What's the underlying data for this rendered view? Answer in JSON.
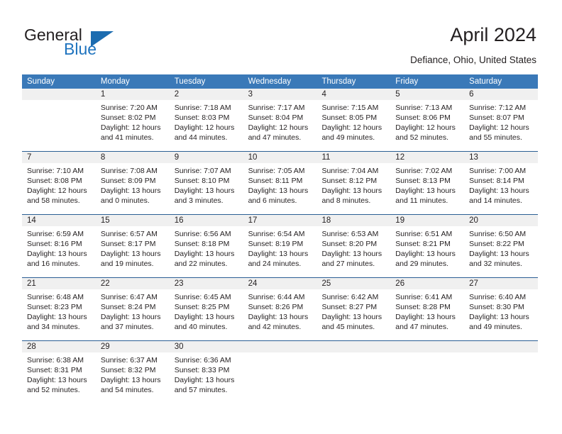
{
  "brand": {
    "name_part1": "General",
    "name_part2": "Blue",
    "accent_color": "#1c6cb0"
  },
  "header": {
    "title": "April 2024",
    "location": "Defiance, Ohio, United States"
  },
  "calendar": {
    "header_bg": "#3a79b8",
    "row_divider_color": "#2b5f94",
    "date_band_bg": "#f0f0f0",
    "weekdays": [
      "Sunday",
      "Monday",
      "Tuesday",
      "Wednesday",
      "Thursday",
      "Friday",
      "Saturday"
    ],
    "weeks": [
      [
        {
          "day": "",
          "sunrise": "",
          "sunset": "",
          "daylight_line1": "",
          "daylight_line2": ""
        },
        {
          "day": "1",
          "sunrise": "Sunrise: 7:20 AM",
          "sunset": "Sunset: 8:02 PM",
          "daylight_line1": "Daylight: 12 hours",
          "daylight_line2": "and 41 minutes."
        },
        {
          "day": "2",
          "sunrise": "Sunrise: 7:18 AM",
          "sunset": "Sunset: 8:03 PM",
          "daylight_line1": "Daylight: 12 hours",
          "daylight_line2": "and 44 minutes."
        },
        {
          "day": "3",
          "sunrise": "Sunrise: 7:17 AM",
          "sunset": "Sunset: 8:04 PM",
          "daylight_line1": "Daylight: 12 hours",
          "daylight_line2": "and 47 minutes."
        },
        {
          "day": "4",
          "sunrise": "Sunrise: 7:15 AM",
          "sunset": "Sunset: 8:05 PM",
          "daylight_line1": "Daylight: 12 hours",
          "daylight_line2": "and 49 minutes."
        },
        {
          "day": "5",
          "sunrise": "Sunrise: 7:13 AM",
          "sunset": "Sunset: 8:06 PM",
          "daylight_line1": "Daylight: 12 hours",
          "daylight_line2": "and 52 minutes."
        },
        {
          "day": "6",
          "sunrise": "Sunrise: 7:12 AM",
          "sunset": "Sunset: 8:07 PM",
          "daylight_line1": "Daylight: 12 hours",
          "daylight_line2": "and 55 minutes."
        }
      ],
      [
        {
          "day": "7",
          "sunrise": "Sunrise: 7:10 AM",
          "sunset": "Sunset: 8:08 PM",
          "daylight_line1": "Daylight: 12 hours",
          "daylight_line2": "and 58 minutes."
        },
        {
          "day": "8",
          "sunrise": "Sunrise: 7:08 AM",
          "sunset": "Sunset: 8:09 PM",
          "daylight_line1": "Daylight: 13 hours",
          "daylight_line2": "and 0 minutes."
        },
        {
          "day": "9",
          "sunrise": "Sunrise: 7:07 AM",
          "sunset": "Sunset: 8:10 PM",
          "daylight_line1": "Daylight: 13 hours",
          "daylight_line2": "and 3 minutes."
        },
        {
          "day": "10",
          "sunrise": "Sunrise: 7:05 AM",
          "sunset": "Sunset: 8:11 PM",
          "daylight_line1": "Daylight: 13 hours",
          "daylight_line2": "and 6 minutes."
        },
        {
          "day": "11",
          "sunrise": "Sunrise: 7:04 AM",
          "sunset": "Sunset: 8:12 PM",
          "daylight_line1": "Daylight: 13 hours",
          "daylight_line2": "and 8 minutes."
        },
        {
          "day": "12",
          "sunrise": "Sunrise: 7:02 AM",
          "sunset": "Sunset: 8:13 PM",
          "daylight_line1": "Daylight: 13 hours",
          "daylight_line2": "and 11 minutes."
        },
        {
          "day": "13",
          "sunrise": "Sunrise: 7:00 AM",
          "sunset": "Sunset: 8:14 PM",
          "daylight_line1": "Daylight: 13 hours",
          "daylight_line2": "and 14 minutes."
        }
      ],
      [
        {
          "day": "14",
          "sunrise": "Sunrise: 6:59 AM",
          "sunset": "Sunset: 8:16 PM",
          "daylight_line1": "Daylight: 13 hours",
          "daylight_line2": "and 16 minutes."
        },
        {
          "day": "15",
          "sunrise": "Sunrise: 6:57 AM",
          "sunset": "Sunset: 8:17 PM",
          "daylight_line1": "Daylight: 13 hours",
          "daylight_line2": "and 19 minutes."
        },
        {
          "day": "16",
          "sunrise": "Sunrise: 6:56 AM",
          "sunset": "Sunset: 8:18 PM",
          "daylight_line1": "Daylight: 13 hours",
          "daylight_line2": "and 22 minutes."
        },
        {
          "day": "17",
          "sunrise": "Sunrise: 6:54 AM",
          "sunset": "Sunset: 8:19 PM",
          "daylight_line1": "Daylight: 13 hours",
          "daylight_line2": "and 24 minutes."
        },
        {
          "day": "18",
          "sunrise": "Sunrise: 6:53 AM",
          "sunset": "Sunset: 8:20 PM",
          "daylight_line1": "Daylight: 13 hours",
          "daylight_line2": "and 27 minutes."
        },
        {
          "day": "19",
          "sunrise": "Sunrise: 6:51 AM",
          "sunset": "Sunset: 8:21 PM",
          "daylight_line1": "Daylight: 13 hours",
          "daylight_line2": "and 29 minutes."
        },
        {
          "day": "20",
          "sunrise": "Sunrise: 6:50 AM",
          "sunset": "Sunset: 8:22 PM",
          "daylight_line1": "Daylight: 13 hours",
          "daylight_line2": "and 32 minutes."
        }
      ],
      [
        {
          "day": "21",
          "sunrise": "Sunrise: 6:48 AM",
          "sunset": "Sunset: 8:23 PM",
          "daylight_line1": "Daylight: 13 hours",
          "daylight_line2": "and 34 minutes."
        },
        {
          "day": "22",
          "sunrise": "Sunrise: 6:47 AM",
          "sunset": "Sunset: 8:24 PM",
          "daylight_line1": "Daylight: 13 hours",
          "daylight_line2": "and 37 minutes."
        },
        {
          "day": "23",
          "sunrise": "Sunrise: 6:45 AM",
          "sunset": "Sunset: 8:25 PM",
          "daylight_line1": "Daylight: 13 hours",
          "daylight_line2": "and 40 minutes."
        },
        {
          "day": "24",
          "sunrise": "Sunrise: 6:44 AM",
          "sunset": "Sunset: 8:26 PM",
          "daylight_line1": "Daylight: 13 hours",
          "daylight_line2": "and 42 minutes."
        },
        {
          "day": "25",
          "sunrise": "Sunrise: 6:42 AM",
          "sunset": "Sunset: 8:27 PM",
          "daylight_line1": "Daylight: 13 hours",
          "daylight_line2": "and 45 minutes."
        },
        {
          "day": "26",
          "sunrise": "Sunrise: 6:41 AM",
          "sunset": "Sunset: 8:28 PM",
          "daylight_line1": "Daylight: 13 hours",
          "daylight_line2": "and 47 minutes."
        },
        {
          "day": "27",
          "sunrise": "Sunrise: 6:40 AM",
          "sunset": "Sunset: 8:30 PM",
          "daylight_line1": "Daylight: 13 hours",
          "daylight_line2": "and 49 minutes."
        }
      ],
      [
        {
          "day": "28",
          "sunrise": "Sunrise: 6:38 AM",
          "sunset": "Sunset: 8:31 PM",
          "daylight_line1": "Daylight: 13 hours",
          "daylight_line2": "and 52 minutes."
        },
        {
          "day": "29",
          "sunrise": "Sunrise: 6:37 AM",
          "sunset": "Sunset: 8:32 PM",
          "daylight_line1": "Daylight: 13 hours",
          "daylight_line2": "and 54 minutes."
        },
        {
          "day": "30",
          "sunrise": "Sunrise: 6:36 AM",
          "sunset": "Sunset: 8:33 PM",
          "daylight_line1": "Daylight: 13 hours",
          "daylight_line2": "and 57 minutes."
        },
        {
          "day": "",
          "sunrise": "",
          "sunset": "",
          "daylight_line1": "",
          "daylight_line2": ""
        },
        {
          "day": "",
          "sunrise": "",
          "sunset": "",
          "daylight_line1": "",
          "daylight_line2": ""
        },
        {
          "day": "",
          "sunrise": "",
          "sunset": "",
          "daylight_line1": "",
          "daylight_line2": ""
        },
        {
          "day": "",
          "sunrise": "",
          "sunset": "",
          "daylight_line1": "",
          "daylight_line2": ""
        }
      ]
    ]
  }
}
